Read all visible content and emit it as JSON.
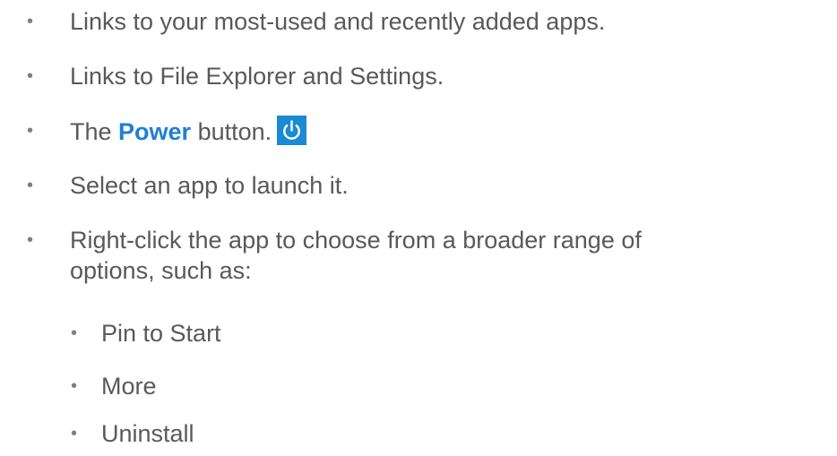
{
  "bullets": [
    {
      "text": "Links to your most-used and recently added apps."
    },
    {
      "text": "Links to File Explorer and Settings."
    },
    {
      "prefix": "The ",
      "emphasis": "Power",
      "suffix": " button.",
      "icon": "power-icon"
    },
    {
      "text": "Select an app to launch it."
    },
    {
      "line1": "Right-click the app to choose from a broader range of",
      "line2": "options, such as:"
    }
  ],
  "sub_bullets": [
    {
      "text": "Pin to Start"
    },
    {
      "text": "More"
    },
    {
      "text": "Uninstall"
    }
  ],
  "bullet_glyph": "•",
  "colors": {
    "text": "#595959",
    "emphasis": "#1f7fd4",
    "icon_background": "#1a8ad4"
  }
}
